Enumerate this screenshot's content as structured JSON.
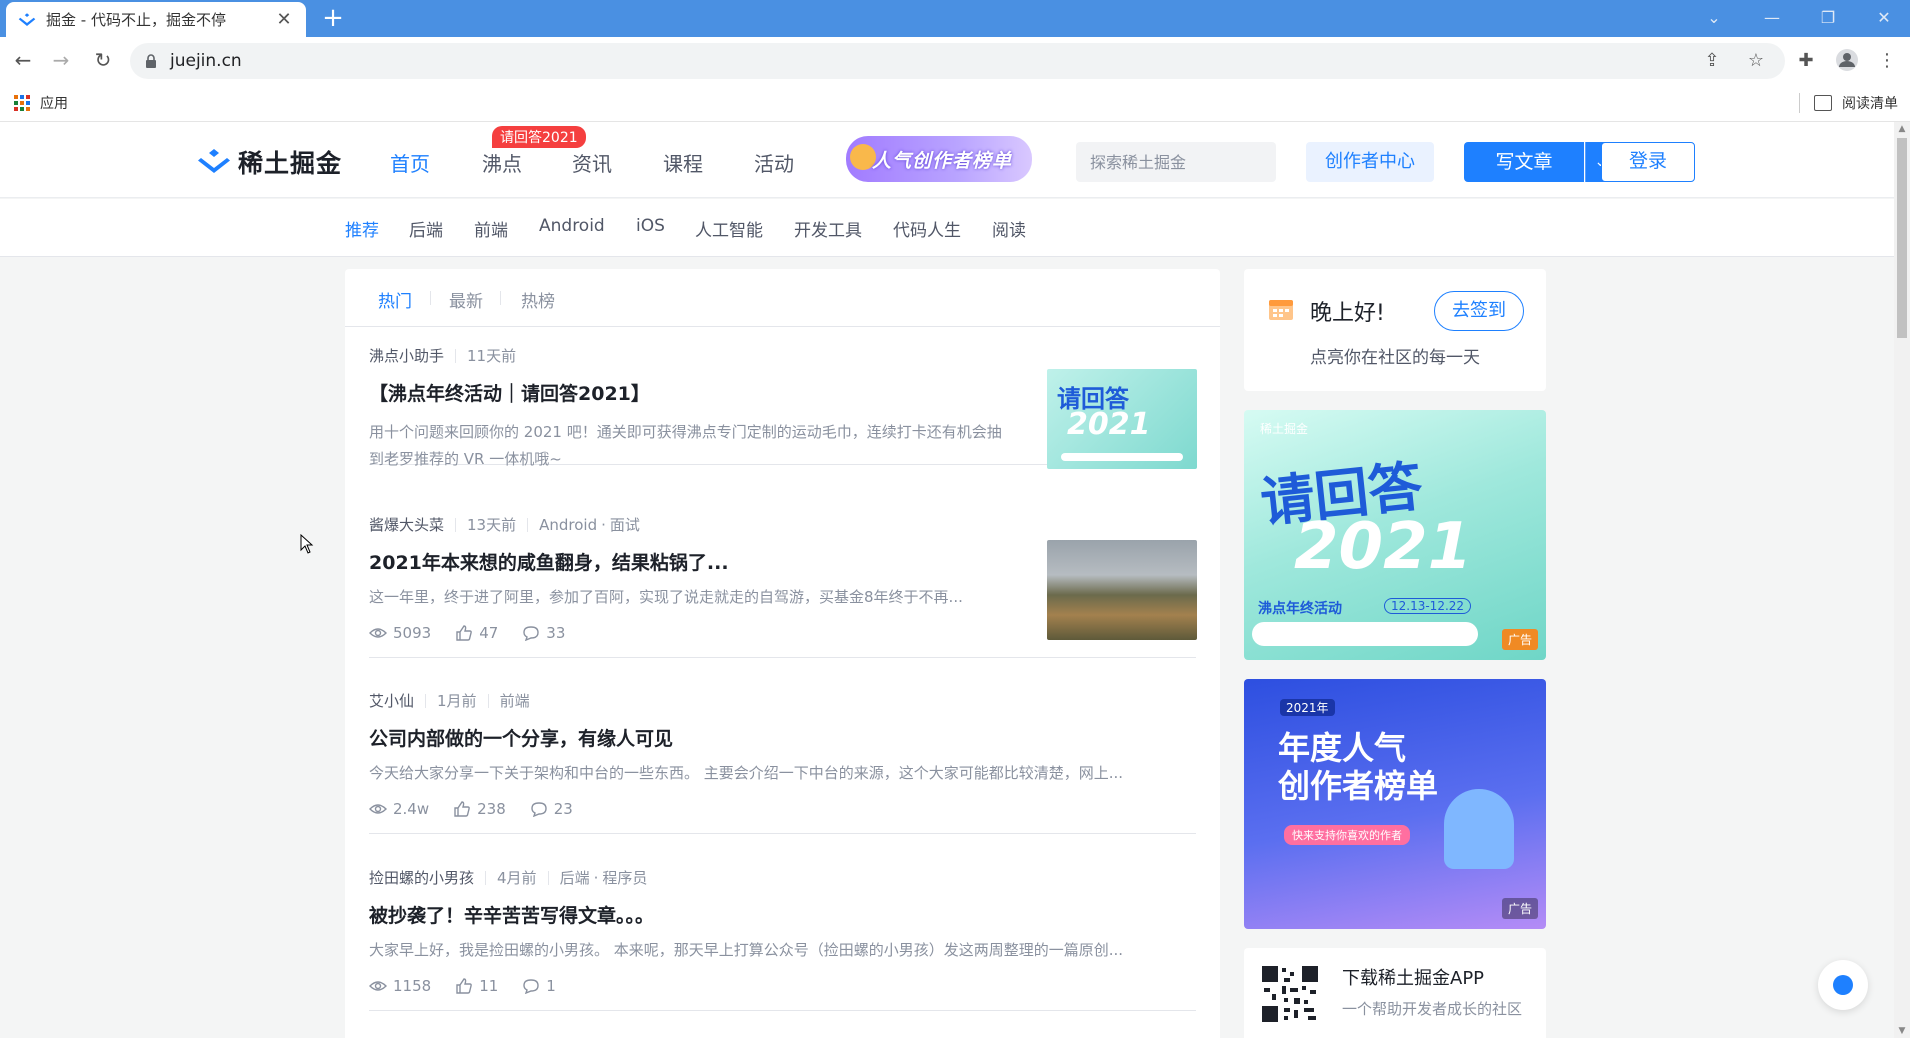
{
  "browser": {
    "tab_title": "掘金 - 代码不止，掘金不停",
    "url": "juejin.cn",
    "bookmarks": {
      "apps_label": "应用",
      "reading_list_label": "阅读清单"
    }
  },
  "header": {
    "logo_text": "稀土掘金",
    "nav": [
      "首页",
      "沸点",
      "资讯",
      "课程",
      "活动"
    ],
    "hot_badge": "请回答2021",
    "promo_text": "人气创作者榜单",
    "search_placeholder": "探索稀土掘金",
    "creator_center": "创作者中心",
    "write_label": "写文章",
    "login_label": "登录"
  },
  "categories": [
    "推荐",
    "后端",
    "前端",
    "Android",
    "iOS",
    "人工智能",
    "开发工具",
    "代码人生",
    "阅读"
  ],
  "feed": {
    "tabs": [
      "热门",
      "最新",
      "热榜"
    ],
    "articles": [
      {
        "author": "沸点小助手",
        "time": "11天前",
        "tags": [],
        "title": "【沸点年终活动｜请回答2021】",
        "abstract": "用十个问题来回顾你的 2021 吧！通关即可获得沸点专门定制的运动毛巾，连续打卡还有机会抽到老罗推荐的 VR 一体机哦~"
      },
      {
        "author": "酱爆大头菜",
        "time": "13天前",
        "tags": [
          "Android",
          "面试"
        ],
        "title": "2021年本来想的咸鱼翻身，结果粘锅了...",
        "abstract": "这一年里，终于进了阿里，参加了百阿，实现了说走就走的自驾游，买基金8年终于不再...",
        "views": "5093",
        "likes": "47",
        "comments": "33"
      },
      {
        "author": "艾小仙",
        "time": "1月前",
        "tags": [
          "前端"
        ],
        "title": "公司内部做的一个分享，有缘人可见",
        "abstract": "今天给大家分享一下关于架构和中台的一些东西。 主要会介绍一下中台的来源，这个大家可能都比较清楚，网上...",
        "views": "2.4w",
        "likes": "238",
        "comments": "23"
      },
      {
        "author": "捡田螺的小男孩",
        "time": "4月前",
        "tags": [
          "后端",
          "程序员"
        ],
        "title": "被抄袭了！辛辛苦苦写得文章。。。",
        "abstract": "大家早上好，我是捡田螺的小男孩。 本来呢，那天早上打算公众号（捡田螺的小男孩）发这两周整理的一篇原创...",
        "views": "1158",
        "likes": "11",
        "comments": "1"
      }
    ],
    "thumb1": {
      "line1": "请回答",
      "line2": "2021"
    }
  },
  "sidebar": {
    "greeting": "晚上好!",
    "greeting_sub": "点亮你在社区的每一天",
    "signin_label": "去签到",
    "ad1": {
      "brand": "稀土掘金",
      "title": "请回答",
      "year": "2021",
      "event": "沸点年终活动",
      "dates": "12.13-12.22",
      "tag": "广告"
    },
    "ad2": {
      "year_tag": "2021年",
      "line1": "年度人气",
      "line2": "创作者榜单",
      "cta": "快来支持你喜欢的作者",
      "tag": "广告"
    },
    "app_title": "下载稀土掘金APP",
    "app_sub": "一个帮助开发者成长的社区"
  },
  "colors": {
    "accent": "#1e80ff",
    "badge": "#f53f3f",
    "chrome": "#4a90e2"
  }
}
